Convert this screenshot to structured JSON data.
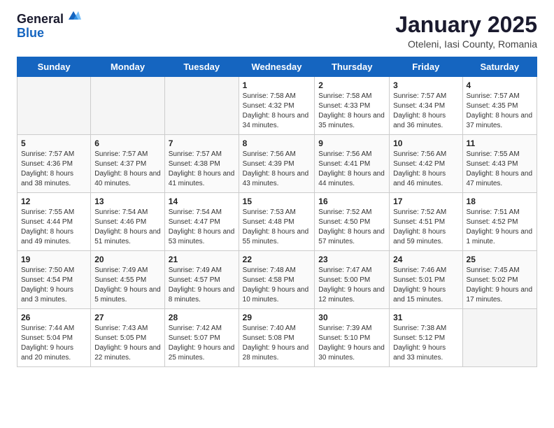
{
  "header": {
    "logo_general": "General",
    "logo_blue": "Blue",
    "month_title": "January 2025",
    "location": "Oteleni, Iasi County, Romania"
  },
  "days_of_week": [
    "Sunday",
    "Monday",
    "Tuesday",
    "Wednesday",
    "Thursday",
    "Friday",
    "Saturday"
  ],
  "weeks": [
    [
      {
        "day": "",
        "sunrise": "",
        "sunset": "",
        "daylight": ""
      },
      {
        "day": "",
        "sunrise": "",
        "sunset": "",
        "daylight": ""
      },
      {
        "day": "",
        "sunrise": "",
        "sunset": "",
        "daylight": ""
      },
      {
        "day": "1",
        "sunrise": "Sunrise: 7:58 AM",
        "sunset": "Sunset: 4:32 PM",
        "daylight": "Daylight: 8 hours and 34 minutes."
      },
      {
        "day": "2",
        "sunrise": "Sunrise: 7:58 AM",
        "sunset": "Sunset: 4:33 PM",
        "daylight": "Daylight: 8 hours and 35 minutes."
      },
      {
        "day": "3",
        "sunrise": "Sunrise: 7:57 AM",
        "sunset": "Sunset: 4:34 PM",
        "daylight": "Daylight: 8 hours and 36 minutes."
      },
      {
        "day": "4",
        "sunrise": "Sunrise: 7:57 AM",
        "sunset": "Sunset: 4:35 PM",
        "daylight": "Daylight: 8 hours and 37 minutes."
      }
    ],
    [
      {
        "day": "5",
        "sunrise": "Sunrise: 7:57 AM",
        "sunset": "Sunset: 4:36 PM",
        "daylight": "Daylight: 8 hours and 38 minutes."
      },
      {
        "day": "6",
        "sunrise": "Sunrise: 7:57 AM",
        "sunset": "Sunset: 4:37 PM",
        "daylight": "Daylight: 8 hours and 40 minutes."
      },
      {
        "day": "7",
        "sunrise": "Sunrise: 7:57 AM",
        "sunset": "Sunset: 4:38 PM",
        "daylight": "Daylight: 8 hours and 41 minutes."
      },
      {
        "day": "8",
        "sunrise": "Sunrise: 7:56 AM",
        "sunset": "Sunset: 4:39 PM",
        "daylight": "Daylight: 8 hours and 43 minutes."
      },
      {
        "day": "9",
        "sunrise": "Sunrise: 7:56 AM",
        "sunset": "Sunset: 4:41 PM",
        "daylight": "Daylight: 8 hours and 44 minutes."
      },
      {
        "day": "10",
        "sunrise": "Sunrise: 7:56 AM",
        "sunset": "Sunset: 4:42 PM",
        "daylight": "Daylight: 8 hours and 46 minutes."
      },
      {
        "day": "11",
        "sunrise": "Sunrise: 7:55 AM",
        "sunset": "Sunset: 4:43 PM",
        "daylight": "Daylight: 8 hours and 47 minutes."
      }
    ],
    [
      {
        "day": "12",
        "sunrise": "Sunrise: 7:55 AM",
        "sunset": "Sunset: 4:44 PM",
        "daylight": "Daylight: 8 hours and 49 minutes."
      },
      {
        "day": "13",
        "sunrise": "Sunrise: 7:54 AM",
        "sunset": "Sunset: 4:46 PM",
        "daylight": "Daylight: 8 hours and 51 minutes."
      },
      {
        "day": "14",
        "sunrise": "Sunrise: 7:54 AM",
        "sunset": "Sunset: 4:47 PM",
        "daylight": "Daylight: 8 hours and 53 minutes."
      },
      {
        "day": "15",
        "sunrise": "Sunrise: 7:53 AM",
        "sunset": "Sunset: 4:48 PM",
        "daylight": "Daylight: 8 hours and 55 minutes."
      },
      {
        "day": "16",
        "sunrise": "Sunrise: 7:52 AM",
        "sunset": "Sunset: 4:50 PM",
        "daylight": "Daylight: 8 hours and 57 minutes."
      },
      {
        "day": "17",
        "sunrise": "Sunrise: 7:52 AM",
        "sunset": "Sunset: 4:51 PM",
        "daylight": "Daylight: 8 hours and 59 minutes."
      },
      {
        "day": "18",
        "sunrise": "Sunrise: 7:51 AM",
        "sunset": "Sunset: 4:52 PM",
        "daylight": "Daylight: 9 hours and 1 minute."
      }
    ],
    [
      {
        "day": "19",
        "sunrise": "Sunrise: 7:50 AM",
        "sunset": "Sunset: 4:54 PM",
        "daylight": "Daylight: 9 hours and 3 minutes."
      },
      {
        "day": "20",
        "sunrise": "Sunrise: 7:49 AM",
        "sunset": "Sunset: 4:55 PM",
        "daylight": "Daylight: 9 hours and 5 minutes."
      },
      {
        "day": "21",
        "sunrise": "Sunrise: 7:49 AM",
        "sunset": "Sunset: 4:57 PM",
        "daylight": "Daylight: 9 hours and 8 minutes."
      },
      {
        "day": "22",
        "sunrise": "Sunrise: 7:48 AM",
        "sunset": "Sunset: 4:58 PM",
        "daylight": "Daylight: 9 hours and 10 minutes."
      },
      {
        "day": "23",
        "sunrise": "Sunrise: 7:47 AM",
        "sunset": "Sunset: 5:00 PM",
        "daylight": "Daylight: 9 hours and 12 minutes."
      },
      {
        "day": "24",
        "sunrise": "Sunrise: 7:46 AM",
        "sunset": "Sunset: 5:01 PM",
        "daylight": "Daylight: 9 hours and 15 minutes."
      },
      {
        "day": "25",
        "sunrise": "Sunrise: 7:45 AM",
        "sunset": "Sunset: 5:02 PM",
        "daylight": "Daylight: 9 hours and 17 minutes."
      }
    ],
    [
      {
        "day": "26",
        "sunrise": "Sunrise: 7:44 AM",
        "sunset": "Sunset: 5:04 PM",
        "daylight": "Daylight: 9 hours and 20 minutes."
      },
      {
        "day": "27",
        "sunrise": "Sunrise: 7:43 AM",
        "sunset": "Sunset: 5:05 PM",
        "daylight": "Daylight: 9 hours and 22 minutes."
      },
      {
        "day": "28",
        "sunrise": "Sunrise: 7:42 AM",
        "sunset": "Sunset: 5:07 PM",
        "daylight": "Daylight: 9 hours and 25 minutes."
      },
      {
        "day": "29",
        "sunrise": "Sunrise: 7:40 AM",
        "sunset": "Sunset: 5:08 PM",
        "daylight": "Daylight: 9 hours and 28 minutes."
      },
      {
        "day": "30",
        "sunrise": "Sunrise: 7:39 AM",
        "sunset": "Sunset: 5:10 PM",
        "daylight": "Daylight: 9 hours and 30 minutes."
      },
      {
        "day": "31",
        "sunrise": "Sunrise: 7:38 AM",
        "sunset": "Sunset: 5:12 PM",
        "daylight": "Daylight: 9 hours and 33 minutes."
      },
      {
        "day": "",
        "sunrise": "",
        "sunset": "",
        "daylight": ""
      }
    ]
  ]
}
